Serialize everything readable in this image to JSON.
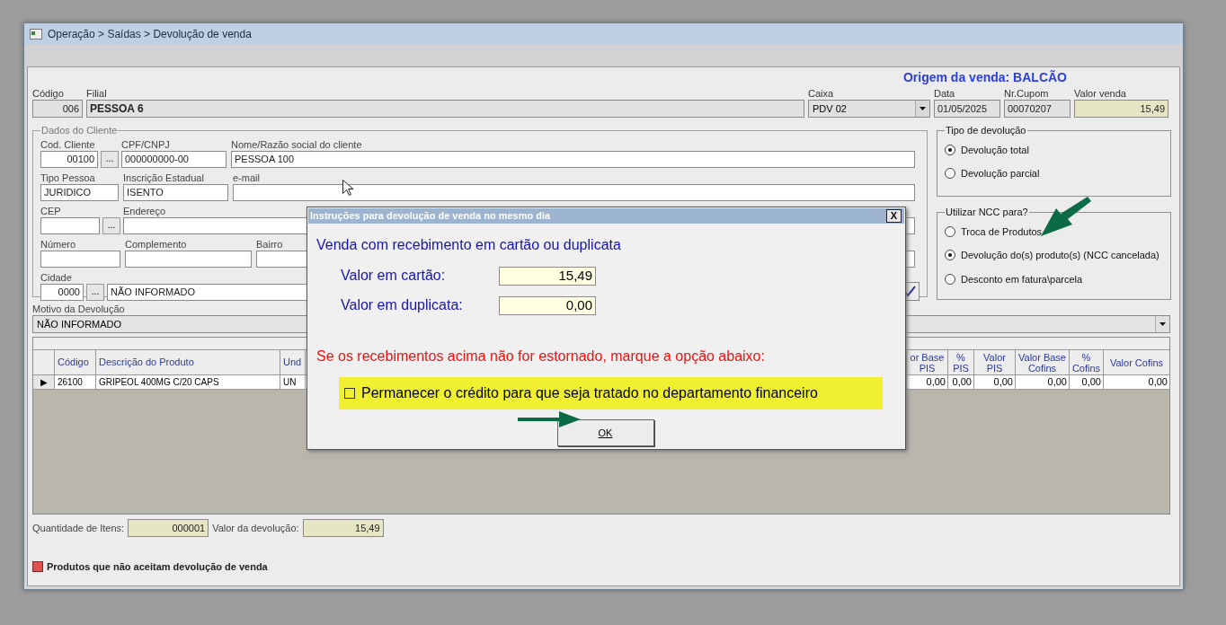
{
  "window": {
    "title": "Operação > Saídas > Devolução de venda"
  },
  "origin": "Origem da venda: BALCÃO",
  "header_fields": [
    {
      "label": "Código",
      "value": "006",
      "kind": "code"
    },
    {
      "label": "Filial",
      "value": "PESSOA 6",
      "kind": "name"
    },
    {
      "label": "Caixa",
      "value": "PDV 02",
      "kind": "select"
    },
    {
      "label": "Data",
      "value": "01/05/2025",
      "kind": "text"
    },
    {
      "label": "Nr.Cupom",
      "value": "00070207",
      "kind": "text"
    },
    {
      "label": "Valor venda",
      "value": "15,49",
      "kind": "amount"
    }
  ],
  "client": {
    "title": "Dados do Cliente",
    "rows": [
      [
        {
          "label": "Cod. Cliente",
          "value": "00100",
          "kind": "lookup",
          "button": "..."
        },
        {
          "label": "CPF/CNPJ",
          "value": "000000000-00",
          "kind": "text"
        },
        {
          "label": "Nome/Razão social do cliente",
          "value": "PESSOA 100",
          "kind": "text"
        }
      ],
      [
        {
          "label": "Tipo Pessoa",
          "value": "JURIDICO",
          "kind": "text"
        },
        {
          "label": "Inscrição Estadual",
          "value": "ISENTO",
          "kind": "text"
        },
        {
          "label": "e-mail",
          "kind": "text"
        }
      ],
      [
        {
          "label": "CEP",
          "kind": "lookup",
          "button": "..."
        },
        {
          "label": "Endereço",
          "kind": "text"
        }
      ],
      [
        {
          "label": "Número",
          "kind": "text"
        },
        {
          "label": "Complemento",
          "kind": "text"
        },
        {
          "label": "Bairro",
          "kind": "text"
        }
      ],
      [
        {
          "label": "Cidade",
          "value": "0000",
          "kind": "lookup",
          "button": "..."
        },
        {
          "value": "NÃO INFORMADO",
          "kind": "text"
        },
        {
          "kind": "confirm"
        }
      ]
    ]
  },
  "return_type": {
    "title": "Tipo de devolução",
    "options": [
      {
        "label": "Devolução total",
        "selected": true
      },
      {
        "label": "Devolução parcial",
        "selected": false
      }
    ]
  },
  "ncc_use": {
    "title": "Utilizar NCC para?",
    "options": [
      {
        "label": "Troca de Produtos",
        "selected": false
      },
      {
        "label": "Devolução do(s) produto(s) (NCC cancelada)",
        "selected": true
      },
      {
        "label": "Desconto em fatura\\parcela",
        "selected": false
      }
    ]
  },
  "reason": {
    "label": "Motivo da Devolução",
    "value": "NÃO INFORMADO"
  },
  "grid": {
    "left_columns": [
      "",
      "Código",
      "Descrição do Produto",
      "Und"
    ],
    "right_columns": [
      "or Base PIS",
      "% PIS",
      "Valor PIS",
      "Valor Base Cofins",
      "% Cofins",
      "Valor Cofins"
    ],
    "rows": [
      {
        "left_cells": [
          "▶",
          "26100",
          "GRIPEOL 400MG C/20 CAPS",
          "UN"
        ],
        "right_cells": [
          "0,00",
          "0,00",
          "0,00",
          "0,00",
          "0,00",
          "0,00"
        ]
      }
    ]
  },
  "totals": [
    {
      "label": "Quantidade de Itens:",
      "value": "000001"
    },
    {
      "label": "Valor da devolução:",
      "value": "15,49"
    }
  ],
  "legend": {
    "label": "Produtos que não aceitam devolução de venda",
    "color": "#e05050"
  },
  "dialog": {
    "title": "Instruções para devolução de venda no mesmo dia",
    "close": "X",
    "heading": "Venda com recebimento em cartão ou duplicata",
    "amounts": [
      {
        "label": "Valor em cartão:",
        "value": "15,49"
      },
      {
        "label": "Valor em duplicata:",
        "value": "0,00"
      }
    ],
    "warning": "Se os recebimentos acima não for estornado, marque a opção abaixo:",
    "credit_option": {
      "label": "Permanecer o crédito para que seja tratado no departamento financeiro",
      "checked": false
    },
    "ok": "OK"
  }
}
